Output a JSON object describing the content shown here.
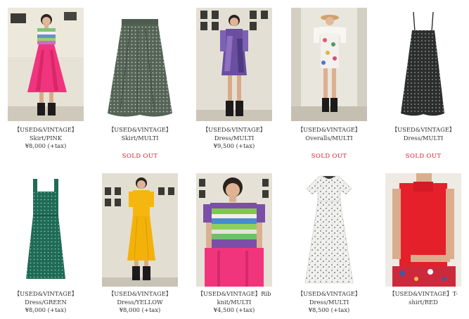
{
  "products": [
    {
      "title": "【USED&VINTAGE】",
      "subtitle": "Skirt/PINK",
      "price": "¥8,000 (+tax)",
      "sold_out": "",
      "image": "model-pink-skirt"
    },
    {
      "title": "【USED&VINTAGE】",
      "subtitle": "Skirt/MULTI",
      "price": "",
      "sold_out": "SOLD OUT",
      "image": "flat-gray-dot-skirt"
    },
    {
      "title": "【USED&VINTAGE】",
      "subtitle": "Dress/MULTI",
      "price": "¥9,500 (+tax)",
      "sold_out": "",
      "image": "model-purple-dress"
    },
    {
      "title": "【USED&VINTAGE】",
      "subtitle": "Overalls/MULTI",
      "price": "",
      "sold_out": "SOLD OUT",
      "image": "model-floral-overalls"
    },
    {
      "title": "【USED&VINTAGE】",
      "subtitle": "Dress/MULTI",
      "price": "",
      "sold_out": "SOLD OUT",
      "image": "flat-dark-slip-dress"
    },
    {
      "title": "【USED&VINTAGE】",
      "subtitle": "Dress/GREEN",
      "price": "¥8,000 (+tax)",
      "sold_out": "",
      "image": "flat-green-dress"
    },
    {
      "title": "【USED&VINTAGE】",
      "subtitle": "Dress/YELLOW",
      "price": "¥8,000 (+tax)",
      "sold_out": "",
      "image": "model-yellow-dress"
    },
    {
      "title": "【USED&VINTAGE】Rib",
      "subtitle": "knit/MULTI",
      "price": "¥4,500 (+tax)",
      "sold_out": "",
      "image": "model-striped-knit"
    },
    {
      "title": "【USED&VINTAGE】",
      "subtitle": "Dress/MULTI",
      "price": "¥8,500 (+tax)",
      "sold_out": "",
      "image": "flat-white-floral-dress"
    },
    {
      "title": "【USED&VINTAGE】T-",
      "subtitle": "shirt/RED",
      "price": "",
      "sold_out": "",
      "image": "model-red-tank"
    }
  ],
  "colors": {
    "sold_out": "#d4202f",
    "text": "#333333"
  }
}
